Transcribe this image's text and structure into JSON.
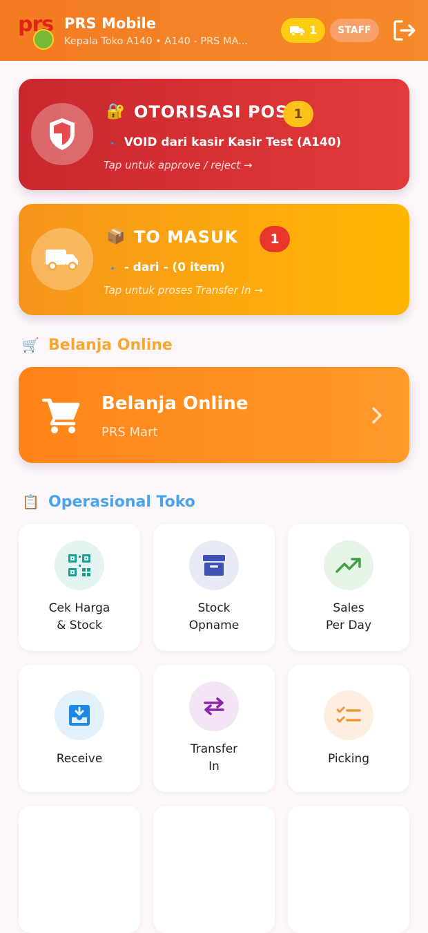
{
  "header": {
    "logo_text": "prs",
    "title": "PRS Mobile",
    "subtitle": "Kepala Toko A140 • A140 - PRS MA...",
    "truck_count": "1",
    "role_badge": "STAFF",
    "truck_icon": "truck-icon",
    "logout_icon": "logout-icon",
    "colors": {
      "bar": "#f47b22",
      "truck_pill": "#ffcc14",
      "staff_pill": "#f8a06a"
    }
  },
  "otorisasi": {
    "emoji": "🔐",
    "title": "OTORISASI POS",
    "count": "1",
    "bullet": "🔹",
    "line": "VOID dari kasir Kasir Test (A140)",
    "tap": "Tap untuk approve / reject →",
    "icon": "shield-icon",
    "color": "#d42f33"
  },
  "to_masuk": {
    "emoji": "📦",
    "title": "TO MASUK",
    "count": "1",
    "bullet": "🔹",
    "line": "- dari - (0 item)",
    "tap": "Tap untuk proses Transfer In →",
    "icon": "truck-icon",
    "color": "#fba50f"
  },
  "belanja_section": {
    "emoji": "🛒",
    "title": "Belanja Online",
    "color": "#f8a733"
  },
  "belanja_card": {
    "title": "Belanja Online",
    "subtitle": "PRS Mart",
    "icon": "cart-icon"
  },
  "operasional_section": {
    "emoji": "📋",
    "title": "Operasional Toko",
    "color": "#4aa4ec"
  },
  "tiles": [
    {
      "line1": "Cek Harga",
      "line2": "& Stock",
      "icon": "qr-scan-icon",
      "color": "#1a9e8f"
    },
    {
      "line1": "Stock",
      "line2": "Opname",
      "icon": "archive-box-icon",
      "color": "#3f51b5"
    },
    {
      "line1": "Sales",
      "line2": "Per Day",
      "icon": "trending-up-icon",
      "color": "#43a047"
    },
    {
      "line1": "Receive",
      "line2": "",
      "icon": "inbox-download-icon",
      "color": "#1e88e5"
    },
    {
      "line1": "Transfer",
      "line2": "In",
      "icon": "swap-arrows-icon",
      "color": "#8e24aa"
    },
    {
      "line1": "Picking",
      "line2": "",
      "icon": "checklist-icon",
      "color": "#f59331"
    }
  ]
}
